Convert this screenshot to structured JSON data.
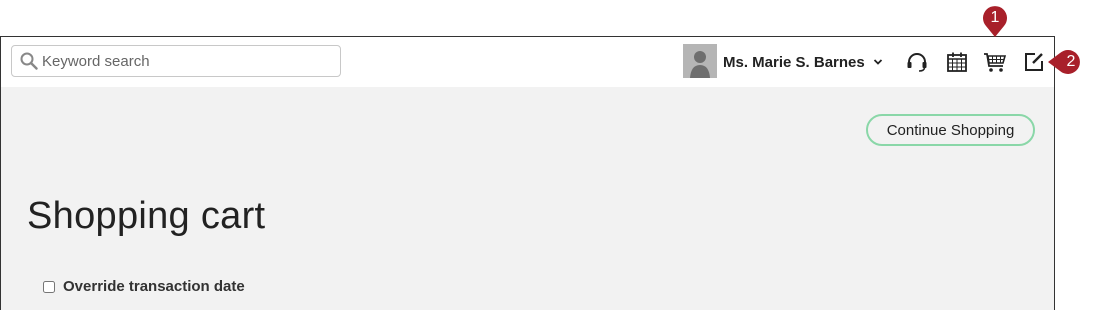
{
  "search": {
    "placeholder": "Keyword search",
    "value": ""
  },
  "user": {
    "name": "Ms. Marie S. Barnes"
  },
  "icons": {
    "search": "search-icon",
    "avatar": "user-avatar",
    "dropdown": "chevron-down-icon",
    "support": "headset-icon",
    "calendar": "calendar-icon",
    "cart": "shopping-cart-icon",
    "edit": "edit-note-icon"
  },
  "actions": {
    "continue_shopping": "Continue Shopping"
  },
  "page": {
    "title": "Shopping cart"
  },
  "override": {
    "label": "Override transaction date",
    "checked": false
  },
  "callouts": [
    {
      "number": "1"
    },
    {
      "number": "2"
    }
  ],
  "colors": {
    "callout": "#a8202a",
    "button_border": "#8ad7a8",
    "content_bg": "#f2f2f2"
  }
}
